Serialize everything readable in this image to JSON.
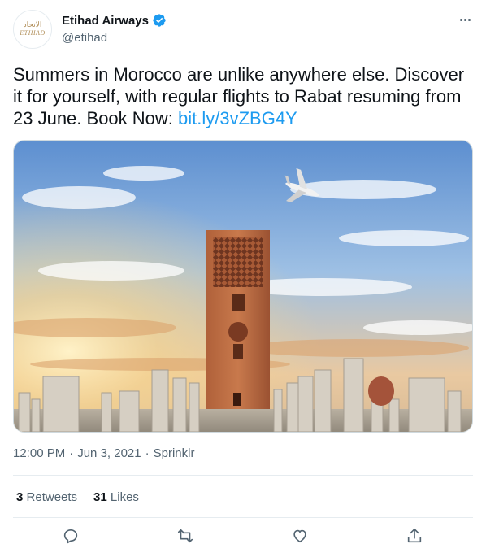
{
  "author": {
    "display_name": "Etihad Airways",
    "handle": "@etihad",
    "avatar_text_arabic": "الاتحاد",
    "avatar_text_latin": "ETIHAD",
    "verified_icon": "verified-badge-icon",
    "brand_color": "#b08d57"
  },
  "tweet": {
    "text": "Summers in Morocco are unlike anywhere else. Discover it for yourself, with regular flights to Rabat resuming from 23 June. Book Now: ",
    "link": "bit.ly/3vZBG4Y",
    "link_color": "#1d9bf0"
  },
  "media": {
    "subject": "Hassan Tower in Rabat with airplane in sky"
  },
  "meta": {
    "time": "12:00 PM",
    "sep1": "·",
    "date": "Jun 3, 2021",
    "sep2": "·",
    "source": "Sprinklr"
  },
  "stats": {
    "retweets_count": "3",
    "retweets_label": "Retweets",
    "likes_count": "31",
    "likes_label": "Likes"
  },
  "actions": {
    "icons": [
      "reply-icon",
      "retweet-icon",
      "like-icon",
      "share-icon"
    ]
  }
}
